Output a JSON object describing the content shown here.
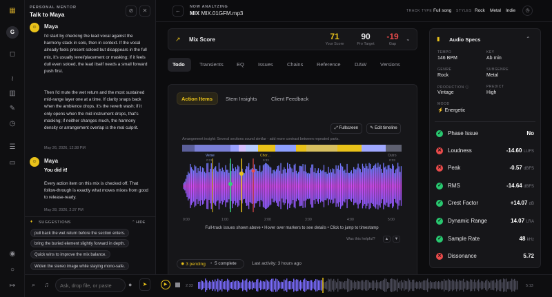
{
  "mentor": {
    "eyebrow": "PERSONAL MENTOR",
    "title": "Talk to Maya",
    "avatar_letter": "G"
  },
  "messages": [
    {
      "author": "Maya",
      "paras": [
        "I'd start by checking the lead vocal against the harmony stack in solo, then in context. If the vocal already feels present soloed but disappears in the full mix, it's usually level/placement or masking; if it feels dull even soloed, the lead itself needs a small forward push first.",
        "Then I'd mute the wet return and the most sustained mid-range layer one at a time. If clarity snaps back when the ambience drops, it's the reverb wash; if it only opens when the mid instrument drops, that's masking; if neither changes much, the harmony density or arrangement overlap is the real culprit."
      ],
      "time": "May 26, 2026, 12:38 PM"
    },
    {
      "author": "Maya",
      "headline": "You did it!",
      "paras": [
        "Every action item on this mix is checked off. That follow-through is exactly what moves mixes from good to release-ready."
      ],
      "time": "May 28, 2026, 2:37 PM"
    }
  ],
  "suggestions": {
    "label": "SUGGESTIONS",
    "hide": "HIDE",
    "items": [
      "pull back the wet return before the section enters.",
      "bring the buried element slightly forward in depth.",
      "Quick wins to improve the mix balance.",
      "Widen the stereo image while staying mono-safe."
    ]
  },
  "composer": {
    "placeholder": "Ask, drop file, or paste"
  },
  "header": {
    "now_analyzing": "NOW ANALYZING",
    "file_prefix": "MIX",
    "file_name": "MIX.01GFM.mp3",
    "track_type_label": "TRACK TYPE",
    "track_type": "Full song",
    "styles_label": "STYLES",
    "styles": [
      "Rock",
      "Metal",
      "Indie"
    ]
  },
  "score": {
    "title": "Mix Score",
    "your_score": "71",
    "your_label": "Your Score",
    "pro_target": "90",
    "pro_label": "Pro Target",
    "gap": "-19",
    "gap_label": "Gap"
  },
  "tabs": [
    "Todo",
    "Transients",
    "EQ",
    "Issues",
    "Chains",
    "Reference",
    "DAW",
    "Versions"
  ],
  "subtabs": [
    "Action Items",
    "Stem Insights",
    "Client Feedback"
  ],
  "waveform": {
    "fullscreen": "Fullscreen",
    "edit_timeline": "Edit timeline",
    "insight": "Arrangement insight: Several sections sound similar - add more contrast between repeated parts.",
    "markers": [
      {
        "name": "Verse",
        "time": "0:21"
      },
      {
        "name": "Chor...",
        "time": "0:33"
      },
      {
        "name": "Outro",
        "time": "0:33"
      }
    ],
    "ticks": [
      "0:00",
      "1:00",
      "2:00",
      "3:00",
      "4:00",
      "5:00"
    ],
    "hint": "Full-track issues shown above • Hover over markers to see details • Click to jump to timestamp",
    "helpful": "Was this helpful?"
  },
  "footer": {
    "pending": "3 pending",
    "complete": "5 complete",
    "activity": "Last activity: 3 hours ago"
  },
  "specs": {
    "title": "Audio Specs",
    "fields": [
      {
        "label": "TEMPO",
        "value": "146 BPM"
      },
      {
        "label": "KEY",
        "value": "Ab min"
      },
      {
        "label": "GENRE",
        "value": "Rock"
      },
      {
        "label": "SUBGENRE",
        "value": "Metal"
      },
      {
        "label": "PRODUCTION",
        "value": "Vintage"
      },
      {
        "label": "PREDICT",
        "value": "High"
      },
      {
        "label": "MOOD",
        "value": "Energetic"
      }
    ],
    "rows": [
      {
        "label": "Phase Issue",
        "value": "No",
        "unit": "",
        "status": "ok"
      },
      {
        "label": "Loudness",
        "value": "-14.60",
        "unit": "LUFS",
        "status": "bad"
      },
      {
        "label": "Peak",
        "value": "-0.57",
        "unit": "dBFS",
        "status": "bad"
      },
      {
        "label": "RMS",
        "value": "-14.64",
        "unit": "dBFS",
        "status": "ok"
      },
      {
        "label": "Crest Factor",
        "value": "+14.07",
        "unit": "dB",
        "status": "ok"
      },
      {
        "label": "Dynamic Range",
        "value": "14.07",
        "unit": "LRA",
        "status": "ok"
      },
      {
        "label": "Sample Rate",
        "value": "48",
        "unit": "kHz",
        "status": "ok"
      },
      {
        "label": "Dissonance",
        "value": "5.72",
        "unit": "",
        "status": "bad"
      }
    ]
  },
  "player": {
    "current": "2:33",
    "total": "5:13"
  },
  "colors": {
    "accent": "#e9c21a",
    "ok": "#28c76f",
    "bad": "#ea4b4b"
  }
}
